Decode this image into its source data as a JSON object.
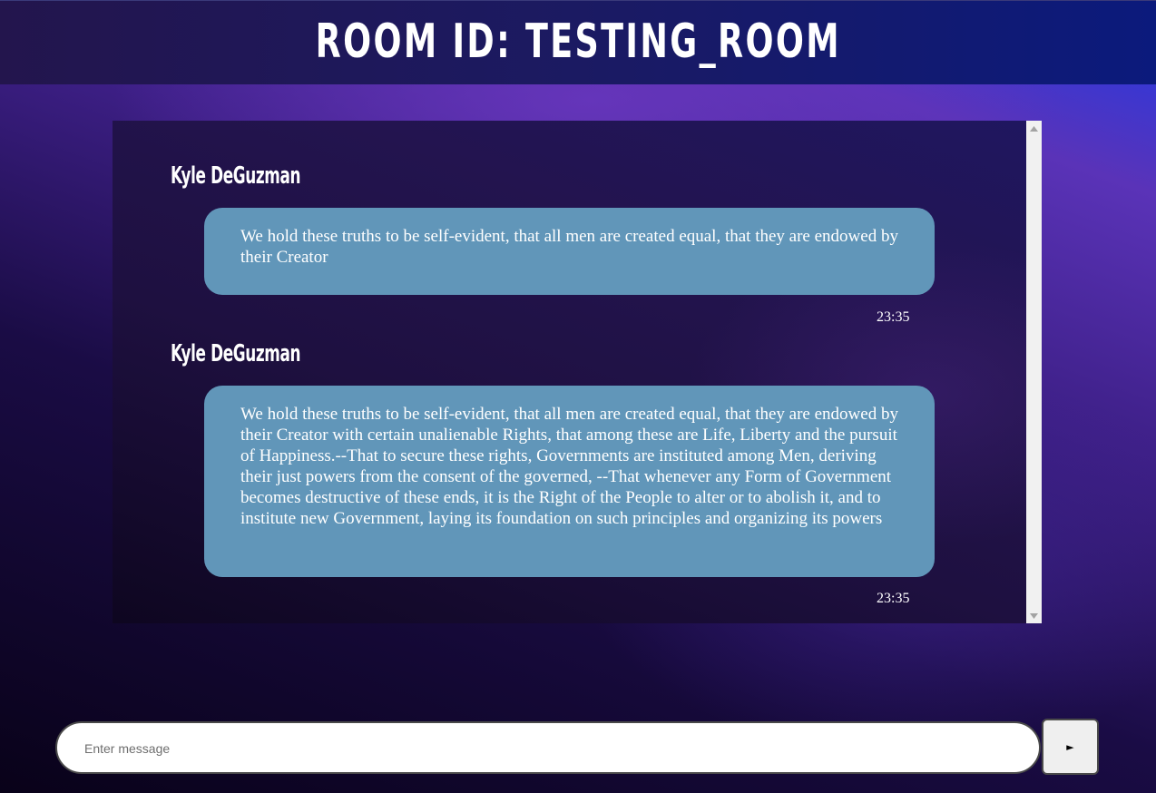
{
  "header": {
    "title": "ROOM ID: TESTING_ROOM"
  },
  "messages": [
    {
      "sender": "Kyle DeGuzman",
      "text": "We hold these truths to be self-evident, that all men are created equal, that they are endowed by their Creator",
      "time": "23:35"
    },
    {
      "sender": "Kyle DeGuzman",
      "text": "We hold these truths to be self-evident, that all men are created equal, that they are endowed by their Creator with certain unalienable Rights, that among these are Life, Liberty and the pursuit of Happiness.--That to secure these rights, Governments are instituted among Men, deriving their just powers from the consent of the governed, --That whenever any Form of Government becomes destructive of these ends, it is the Right of the People to alter or to abolish it, and to institute new Government, laying its foundation on such principles and organizing its powers",
      "time": "23:35"
    }
  ],
  "composer": {
    "placeholder": "Enter message",
    "value": "",
    "send_icon": "play-triangle",
    "send_glyph": "►"
  },
  "colors": {
    "bubble": "#6196b9",
    "header_bg": "#1b1a62",
    "text": "#ffffff"
  }
}
